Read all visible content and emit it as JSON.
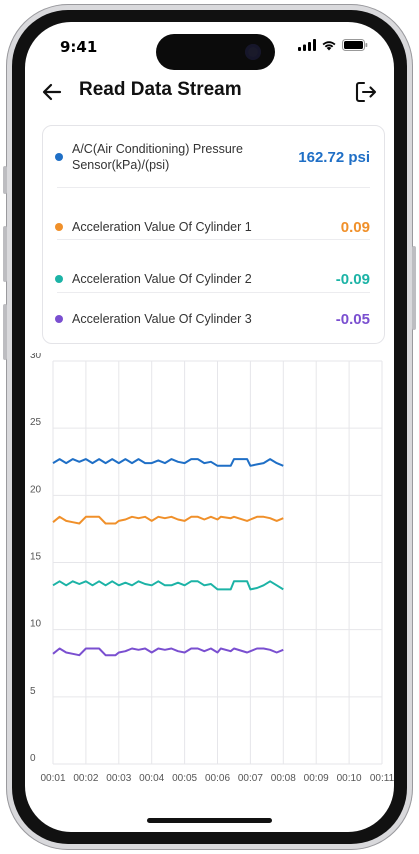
{
  "status_bar": {
    "time": "9:41"
  },
  "header": {
    "title": "Read Data Stream"
  },
  "readings": [
    {
      "label": "A/C(Air Conditioning) Pressure Sensor(kPa)/(psi)",
      "value": "162.72 psi",
      "color": "#1f6fc6"
    },
    {
      "label": "Acceleration Value Of Cylinder 1",
      "value": "0.09",
      "color": "#f0902a"
    },
    {
      "label": "Acceleration Value Of Cylinder 2",
      "value": "-0.09",
      "color": "#1cb3a6"
    },
    {
      "label": "Acceleration Value Of Cylinder 3",
      "value": "-0.05",
      "color": "#7a4fd0"
    }
  ],
  "chart_data": {
    "type": "line",
    "ylim": [
      0,
      30
    ],
    "yticks": [
      0,
      5,
      10,
      15,
      20,
      25,
      30
    ],
    "xticks": [
      "00:01",
      "00:02",
      "00:03",
      "00:04",
      "00:05",
      "00:06",
      "00:07",
      "00:08",
      "00:09",
      "00:10",
      "00:11"
    ],
    "xlim": [
      1,
      11
    ],
    "grid": true,
    "series": [
      {
        "color": "#1f6fc6",
        "x": [
          1,
          1.2,
          1.4,
          1.6,
          1.8,
          2,
          2.2,
          2.4,
          2.6,
          2.8,
          3,
          3.2,
          3.4,
          3.6,
          3.8,
          4,
          4.2,
          4.4,
          4.6,
          4.8,
          5,
          5.2,
          5.4,
          5.6,
          5.8,
          6,
          6.1,
          6.4,
          6.5,
          6.9,
          7,
          7.2,
          7.4,
          7.6,
          7.8,
          8
        ],
        "y": [
          22.4,
          22.7,
          22.4,
          22.7,
          22.5,
          22.7,
          22.4,
          22.7,
          22.4,
          22.7,
          22.4,
          22.7,
          22.4,
          22.7,
          22.4,
          22.4,
          22.6,
          22.4,
          22.7,
          22.5,
          22.4,
          22.7,
          22.7,
          22.4,
          22.5,
          22.2,
          22.2,
          22.2,
          22.7,
          22.7,
          22.2,
          22.3,
          22.4,
          22.7,
          22.4,
          22.2
        ]
      },
      {
        "color": "#f0902a",
        "x": [
          1,
          1.2,
          1.4,
          1.6,
          1.8,
          2,
          2.4,
          2.6,
          2.9,
          3,
          3.2,
          3.4,
          3.6,
          3.8,
          4,
          4.2,
          4.4,
          4.6,
          4.8,
          5,
          5.2,
          5.4,
          5.6,
          5.8,
          6,
          6.1,
          6.4,
          6.5,
          6.9,
          7,
          7.2,
          7.4,
          7.6,
          7.8,
          8
        ],
        "y": [
          18.0,
          18.4,
          18.1,
          18.0,
          17.9,
          18.4,
          18.4,
          17.9,
          17.9,
          18.1,
          18.2,
          18.4,
          18.3,
          18.4,
          18.1,
          18.4,
          18.3,
          18.4,
          18.2,
          18.1,
          18.4,
          18.4,
          18.2,
          18.4,
          18.2,
          18.4,
          18.3,
          18.4,
          18.1,
          18.2,
          18.4,
          18.4,
          18.3,
          18.1,
          18.3
        ]
      },
      {
        "color": "#1cb3a6",
        "x": [
          1,
          1.2,
          1.4,
          1.6,
          1.8,
          2,
          2.2,
          2.4,
          2.6,
          2.8,
          3,
          3.2,
          3.4,
          3.6,
          3.8,
          4,
          4.2,
          4.4,
          4.6,
          4.8,
          5,
          5.2,
          5.4,
          5.6,
          5.8,
          6,
          6.1,
          6.4,
          6.5,
          6.9,
          7,
          7.2,
          7.4,
          7.6,
          7.8,
          8
        ],
        "y": [
          13.3,
          13.6,
          13.3,
          13.6,
          13.4,
          13.6,
          13.3,
          13.6,
          13.3,
          13.6,
          13.3,
          13.5,
          13.3,
          13.6,
          13.4,
          13.3,
          13.6,
          13.3,
          13.3,
          13.5,
          13.3,
          13.6,
          13.6,
          13.3,
          13.4,
          13.0,
          13.0,
          13.0,
          13.6,
          13.6,
          13.0,
          13.1,
          13.3,
          13.6,
          13.3,
          13.0
        ]
      },
      {
        "color": "#7a4fd0",
        "x": [
          1,
          1.2,
          1.4,
          1.6,
          1.8,
          2,
          2.4,
          2.6,
          2.9,
          3,
          3.2,
          3.4,
          3.6,
          3.8,
          4,
          4.2,
          4.4,
          4.6,
          4.8,
          5,
          5.2,
          5.4,
          5.6,
          5.8,
          6,
          6.1,
          6.4,
          6.5,
          6.9,
          7,
          7.2,
          7.4,
          7.6,
          7.8,
          8
        ],
        "y": [
          8.2,
          8.6,
          8.3,
          8.2,
          8.1,
          8.6,
          8.6,
          8.1,
          8.1,
          8.3,
          8.4,
          8.6,
          8.5,
          8.6,
          8.3,
          8.6,
          8.5,
          8.6,
          8.4,
          8.3,
          8.6,
          8.6,
          8.4,
          8.6,
          8.3,
          8.6,
          8.4,
          8.6,
          8.3,
          8.4,
          8.6,
          8.6,
          8.5,
          8.3,
          8.5
        ]
      }
    ]
  }
}
